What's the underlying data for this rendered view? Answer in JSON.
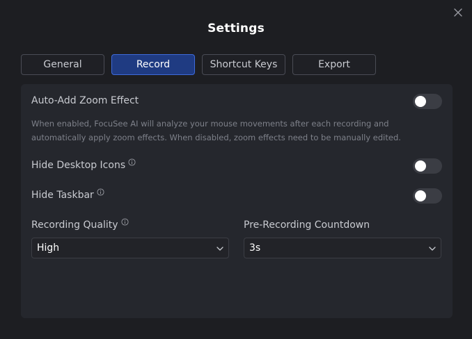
{
  "window": {
    "title": "Settings"
  },
  "tabs": [
    {
      "label": "General",
      "active": false
    },
    {
      "label": "Record",
      "active": true
    },
    {
      "label": "Shortcut Keys",
      "active": false
    },
    {
      "label": "Export",
      "active": false
    }
  ],
  "record": {
    "auto_zoom": {
      "label": "Auto-Add Zoom Effect",
      "description": "When enabled, FocuSee AI will analyze your mouse movements after each recording and automatically apply zoom effects. When disabled, zoom effects need to be manually edited.",
      "enabled": false
    },
    "hide_desktop_icons": {
      "label": "Hide Desktop Icons",
      "enabled": false
    },
    "hide_taskbar": {
      "label": "Hide Taskbar",
      "enabled": false
    },
    "recording_quality": {
      "label": "Recording Quality",
      "value": "High"
    },
    "countdown": {
      "label": "Pre-Recording Countdown",
      "value": "3s"
    }
  },
  "icons": {
    "close": "close-icon",
    "info": "info-icon",
    "chevron": "chevron-down-icon"
  },
  "colors": {
    "background": "#1d1e22",
    "panel": "#25272d",
    "accent_tab_bg": "#1f3b82",
    "accent_tab_border": "#3e6bdc",
    "toggle_off": "#3b3d44"
  }
}
